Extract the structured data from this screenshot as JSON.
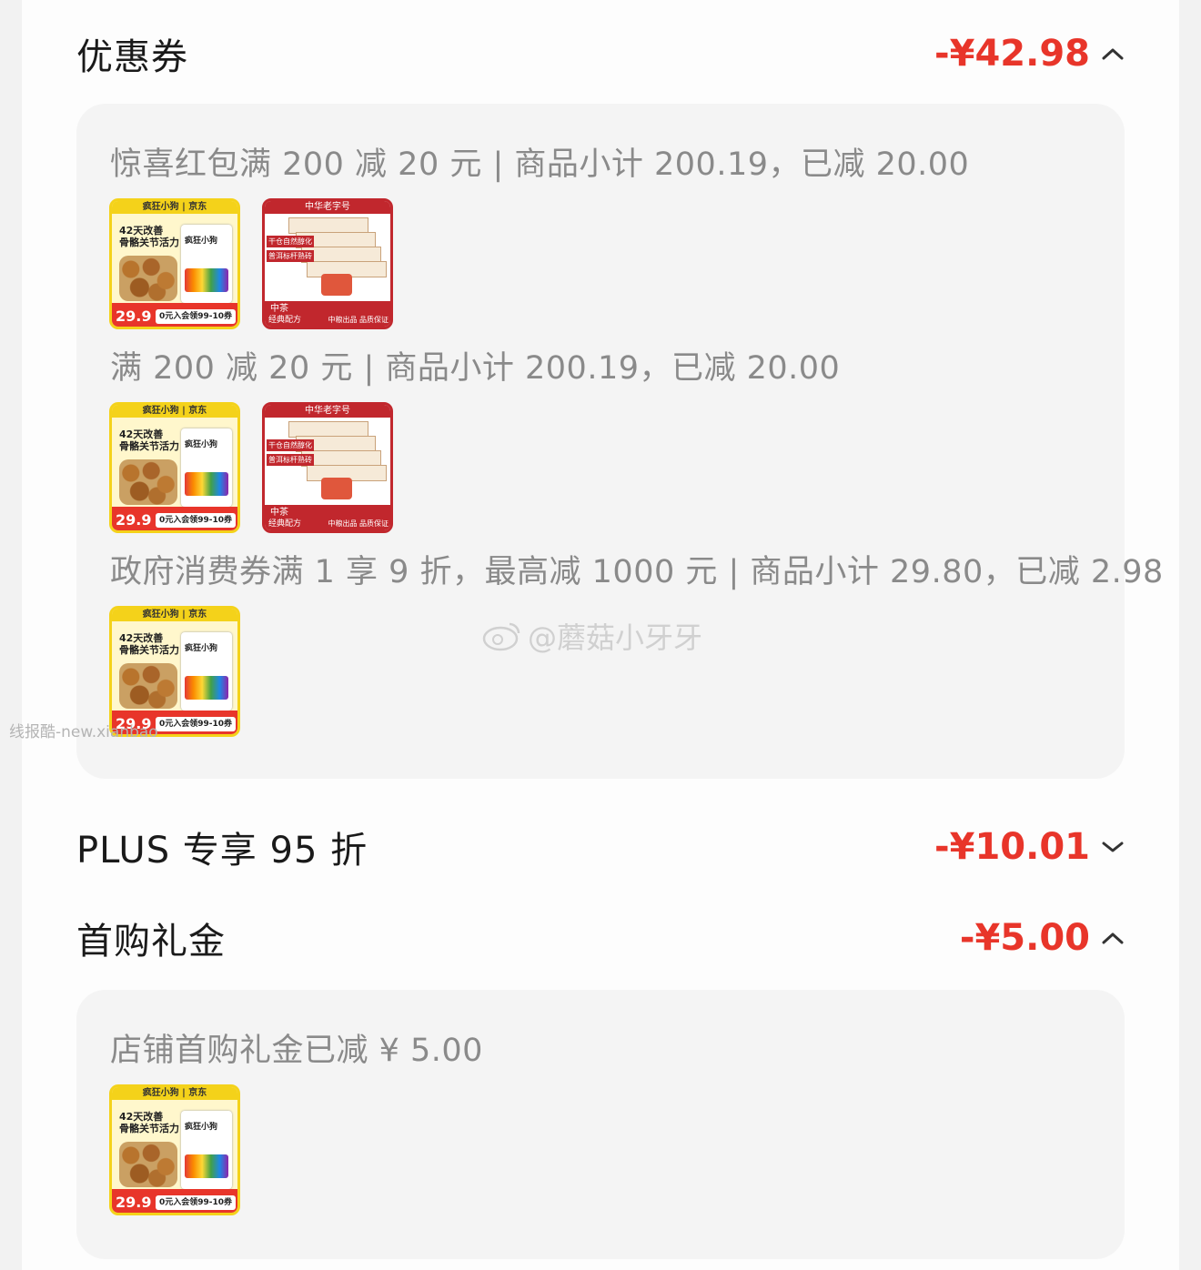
{
  "sections": {
    "coupon": {
      "title": "优惠券",
      "amount": "-¥42.98",
      "expanded": true,
      "items": [
        {
          "text": "惊喜红包满 200 减 20 元 | 商品小计 200.19，已减 20.00",
          "products": [
            "dog-food",
            "tea-brick"
          ]
        },
        {
          "text": "满 200 减 20 元 | 商品小计 200.19，已减 20.00",
          "products": [
            "dog-food",
            "tea-brick"
          ]
        },
        {
          "text": "政府消费券满 1 享 9 折，最高减 1000 元 | 商品小计 29.80，已减 2.98",
          "products": [
            "dog-food"
          ]
        }
      ]
    },
    "plus": {
      "title": "PLUS 专享 95 折",
      "amount": "-¥10.01",
      "expanded": false
    },
    "first_purchase": {
      "title": "首购礼金",
      "amount": "-¥5.00",
      "expanded": true,
      "items": [
        {
          "text": "店铺首购礼金已减 ¥ 5.00",
          "products": [
            "dog-food"
          ]
        }
      ]
    }
  },
  "product_labels": {
    "dog_food": {
      "brand": "疯狂小狗 | 京东",
      "headline_1": "42天改善",
      "headline_2": "骨骼关节活力",
      "bag": "疯狂小狗",
      "price": "29.9",
      "promo": "0元入会领99-10券"
    },
    "tea": {
      "banner": "中华老字号",
      "tag_1": "干仓自然醇化",
      "tag_2": "普洱标杆熟砖",
      "brand": "中茶",
      "footer_1": "经典配方",
      "footer_2": "中粮出品 品质保证"
    }
  },
  "watermark": "@蘑菇小牙牙",
  "site_mark": "线报酷-new.xianbao",
  "colors": {
    "discount_red": "#e8352a",
    "title_text": "#1a1a1a",
    "detail_text": "#8a8a8a",
    "box_bg": "#f4f4f4",
    "page_bg": "#fdfdfd"
  }
}
